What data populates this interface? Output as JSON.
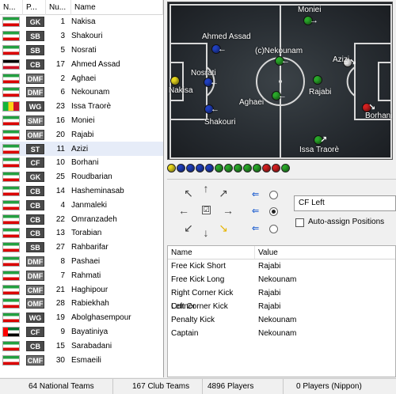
{
  "list": {
    "headers": {
      "nationality": "N...",
      "position": "P...",
      "number": "Nu...",
      "name": "Name"
    },
    "rows": [
      {
        "flag": "iran",
        "pos": "GK",
        "pos_color": "#4a4a4a",
        "num": "1",
        "name": "Nakisa"
      },
      {
        "flag": "iran",
        "pos": "SB",
        "pos_color": "#4a4a4a",
        "num": "3",
        "name": "Shakouri"
      },
      {
        "flag": "iran",
        "pos": "SB",
        "pos_color": "#4a4a4a",
        "num": "5",
        "name": "Nosrati"
      },
      {
        "flag": "egypt",
        "pos": "CB",
        "pos_color": "#4a4a4a",
        "num": "17",
        "name": "Ahmed Assad"
      },
      {
        "flag": "iran",
        "pos": "DMF",
        "pos_color": "#6e6e6e",
        "num": "2",
        "name": "Aghaei"
      },
      {
        "flag": "iran",
        "pos": "DMF",
        "pos_color": "#6e6e6e",
        "num": "6",
        "name": "Nekounam"
      },
      {
        "flag": "mali",
        "pos": "WG",
        "pos_color": "#4a4a4a",
        "num": "23",
        "name": "Issa Traorè"
      },
      {
        "flag": "iran",
        "pos": "SMF",
        "pos_color": "#6e6e6e",
        "num": "16",
        "name": "Moniei"
      },
      {
        "flag": "iran",
        "pos": "OMF",
        "pos_color": "#6e6e6e",
        "num": "20",
        "name": "Rajabi"
      },
      {
        "flag": "iran",
        "pos": "ST",
        "pos_color": "#4a4a4a",
        "num": "11",
        "name": "Azizi"
      },
      {
        "flag": "iran",
        "pos": "CF",
        "pos_color": "#4a4a4a",
        "num": "10",
        "name": "Borhani"
      },
      {
        "flag": "iran",
        "pos": "GK",
        "pos_color": "#4a4a4a",
        "num": "25",
        "name": "Roudbarian"
      },
      {
        "flag": "iran",
        "pos": "CB",
        "pos_color": "#4a4a4a",
        "num": "14",
        "name": "Hasheminasab"
      },
      {
        "flag": "iran",
        "pos": "CB",
        "pos_color": "#4a4a4a",
        "num": "4",
        "name": "Janmaleki"
      },
      {
        "flag": "iran",
        "pos": "CB",
        "pos_color": "#4a4a4a",
        "num": "22",
        "name": "Omranzadeh"
      },
      {
        "flag": "iran",
        "pos": "CB",
        "pos_color": "#4a4a4a",
        "num": "13",
        "name": "Torabian"
      },
      {
        "flag": "iran",
        "pos": "SB",
        "pos_color": "#4a4a4a",
        "num": "27",
        "name": "Rahbarifar"
      },
      {
        "flag": "iran",
        "pos": "DMF",
        "pos_color": "#6e6e6e",
        "num": "8",
        "name": "Pashaei"
      },
      {
        "flag": "iran",
        "pos": "DMF",
        "pos_color": "#6e6e6e",
        "num": "7",
        "name": "Rahmati"
      },
      {
        "flag": "iran",
        "pos": "CMF",
        "pos_color": "#6e6e6e",
        "num": "21",
        "name": "Haghipour"
      },
      {
        "flag": "iran",
        "pos": "OMF",
        "pos_color": "#6e6e6e",
        "num": "28",
        "name": "Rabiekhah"
      },
      {
        "flag": "iran",
        "pos": "WG",
        "pos_color": "#4a4a4a",
        "num": "19",
        "name": "Abolghasempour"
      },
      {
        "flag": "uae",
        "pos": "CF",
        "pos_color": "#4a4a4a",
        "num": "9",
        "name": "Bayatiniya"
      },
      {
        "flag": "iran",
        "pos": "CB",
        "pos_color": "#4a4a4a",
        "num": "15",
        "name": "Sarabadani"
      },
      {
        "flag": "iran",
        "pos": "CMF",
        "pos_color": "#6e6e6e",
        "num": "30",
        "name": "Esmaeili"
      }
    ],
    "selected_name": "Azizi"
  },
  "pitch": {
    "players": [
      {
        "name": "Nakisa",
        "color": "#e8d81e",
        "arrow": ""
      },
      {
        "name": "Nosrati",
        "color": "#2040c0",
        "arrow": "←"
      },
      {
        "name": "Ahmed Assad",
        "color": "#2040c0",
        "arrow": "←"
      },
      {
        "name": "Shakouri",
        "color": "#2040c0",
        "arrow": "←"
      },
      {
        "name": "(c)Nekounam",
        "color": "#2aa82a",
        "arrow": "←"
      },
      {
        "name": "Aghaei",
        "color": "#2aa82a",
        "arrow": "←"
      },
      {
        "name": "Moniei",
        "color": "#2aa82a",
        "arrow": "→"
      },
      {
        "name": "Rajabi",
        "color": "#2aa82a",
        "arrow": ""
      },
      {
        "name": "Issa Traorè",
        "color": "#2aa82a",
        "arrow": "↗"
      },
      {
        "name": "Azizi",
        "color": "#ffffff",
        "arrow": "↘"
      },
      {
        "name": "Borhani",
        "color": "#d42020",
        "arrow": "↘"
      }
    ]
  },
  "balls": {
    "colors": [
      "#e8d81e",
      "#2040c0",
      "#2040c0",
      "#2040c0",
      "#2040c0",
      "#2aa82a",
      "#2aa82a",
      "#2aa82a",
      "#2aa82a",
      "#2aa82a",
      "#d42020",
      "#d42020",
      "#2aa82a"
    ]
  },
  "controls": {
    "directions": [
      "↖",
      "↑",
      "↗",
      "←",
      "→",
      "↙",
      "↓",
      "↘"
    ],
    "active_direction": "↘",
    "center_check": "☑",
    "small_arrow": "⇐",
    "radio_selected_index": 1,
    "position_select": "CF Left",
    "auto_assign_label": "Auto-assign Positions",
    "auto_assign_checked": false
  },
  "props": {
    "headers": {
      "name": "Name",
      "value": "Value"
    },
    "rows": [
      {
        "name": "Free Kick Short",
        "value": "Rajabi"
      },
      {
        "name": "Free Kick Long",
        "value": "Nekounam"
      },
      {
        "name": "Right Corner Kick Corner",
        "value": "Rajabi"
      },
      {
        "name": "Left Corner Kick",
        "value": "Rajabi"
      },
      {
        "name": "Penalty Kick",
        "value": "Nekounam"
      },
      {
        "name": "Captain",
        "value": "Nekounam"
      }
    ]
  },
  "status": {
    "national": "64 National Teams",
    "club": "167 Club Teams",
    "players": "4896 Players",
    "selection": "0 Players (Nippon)"
  }
}
